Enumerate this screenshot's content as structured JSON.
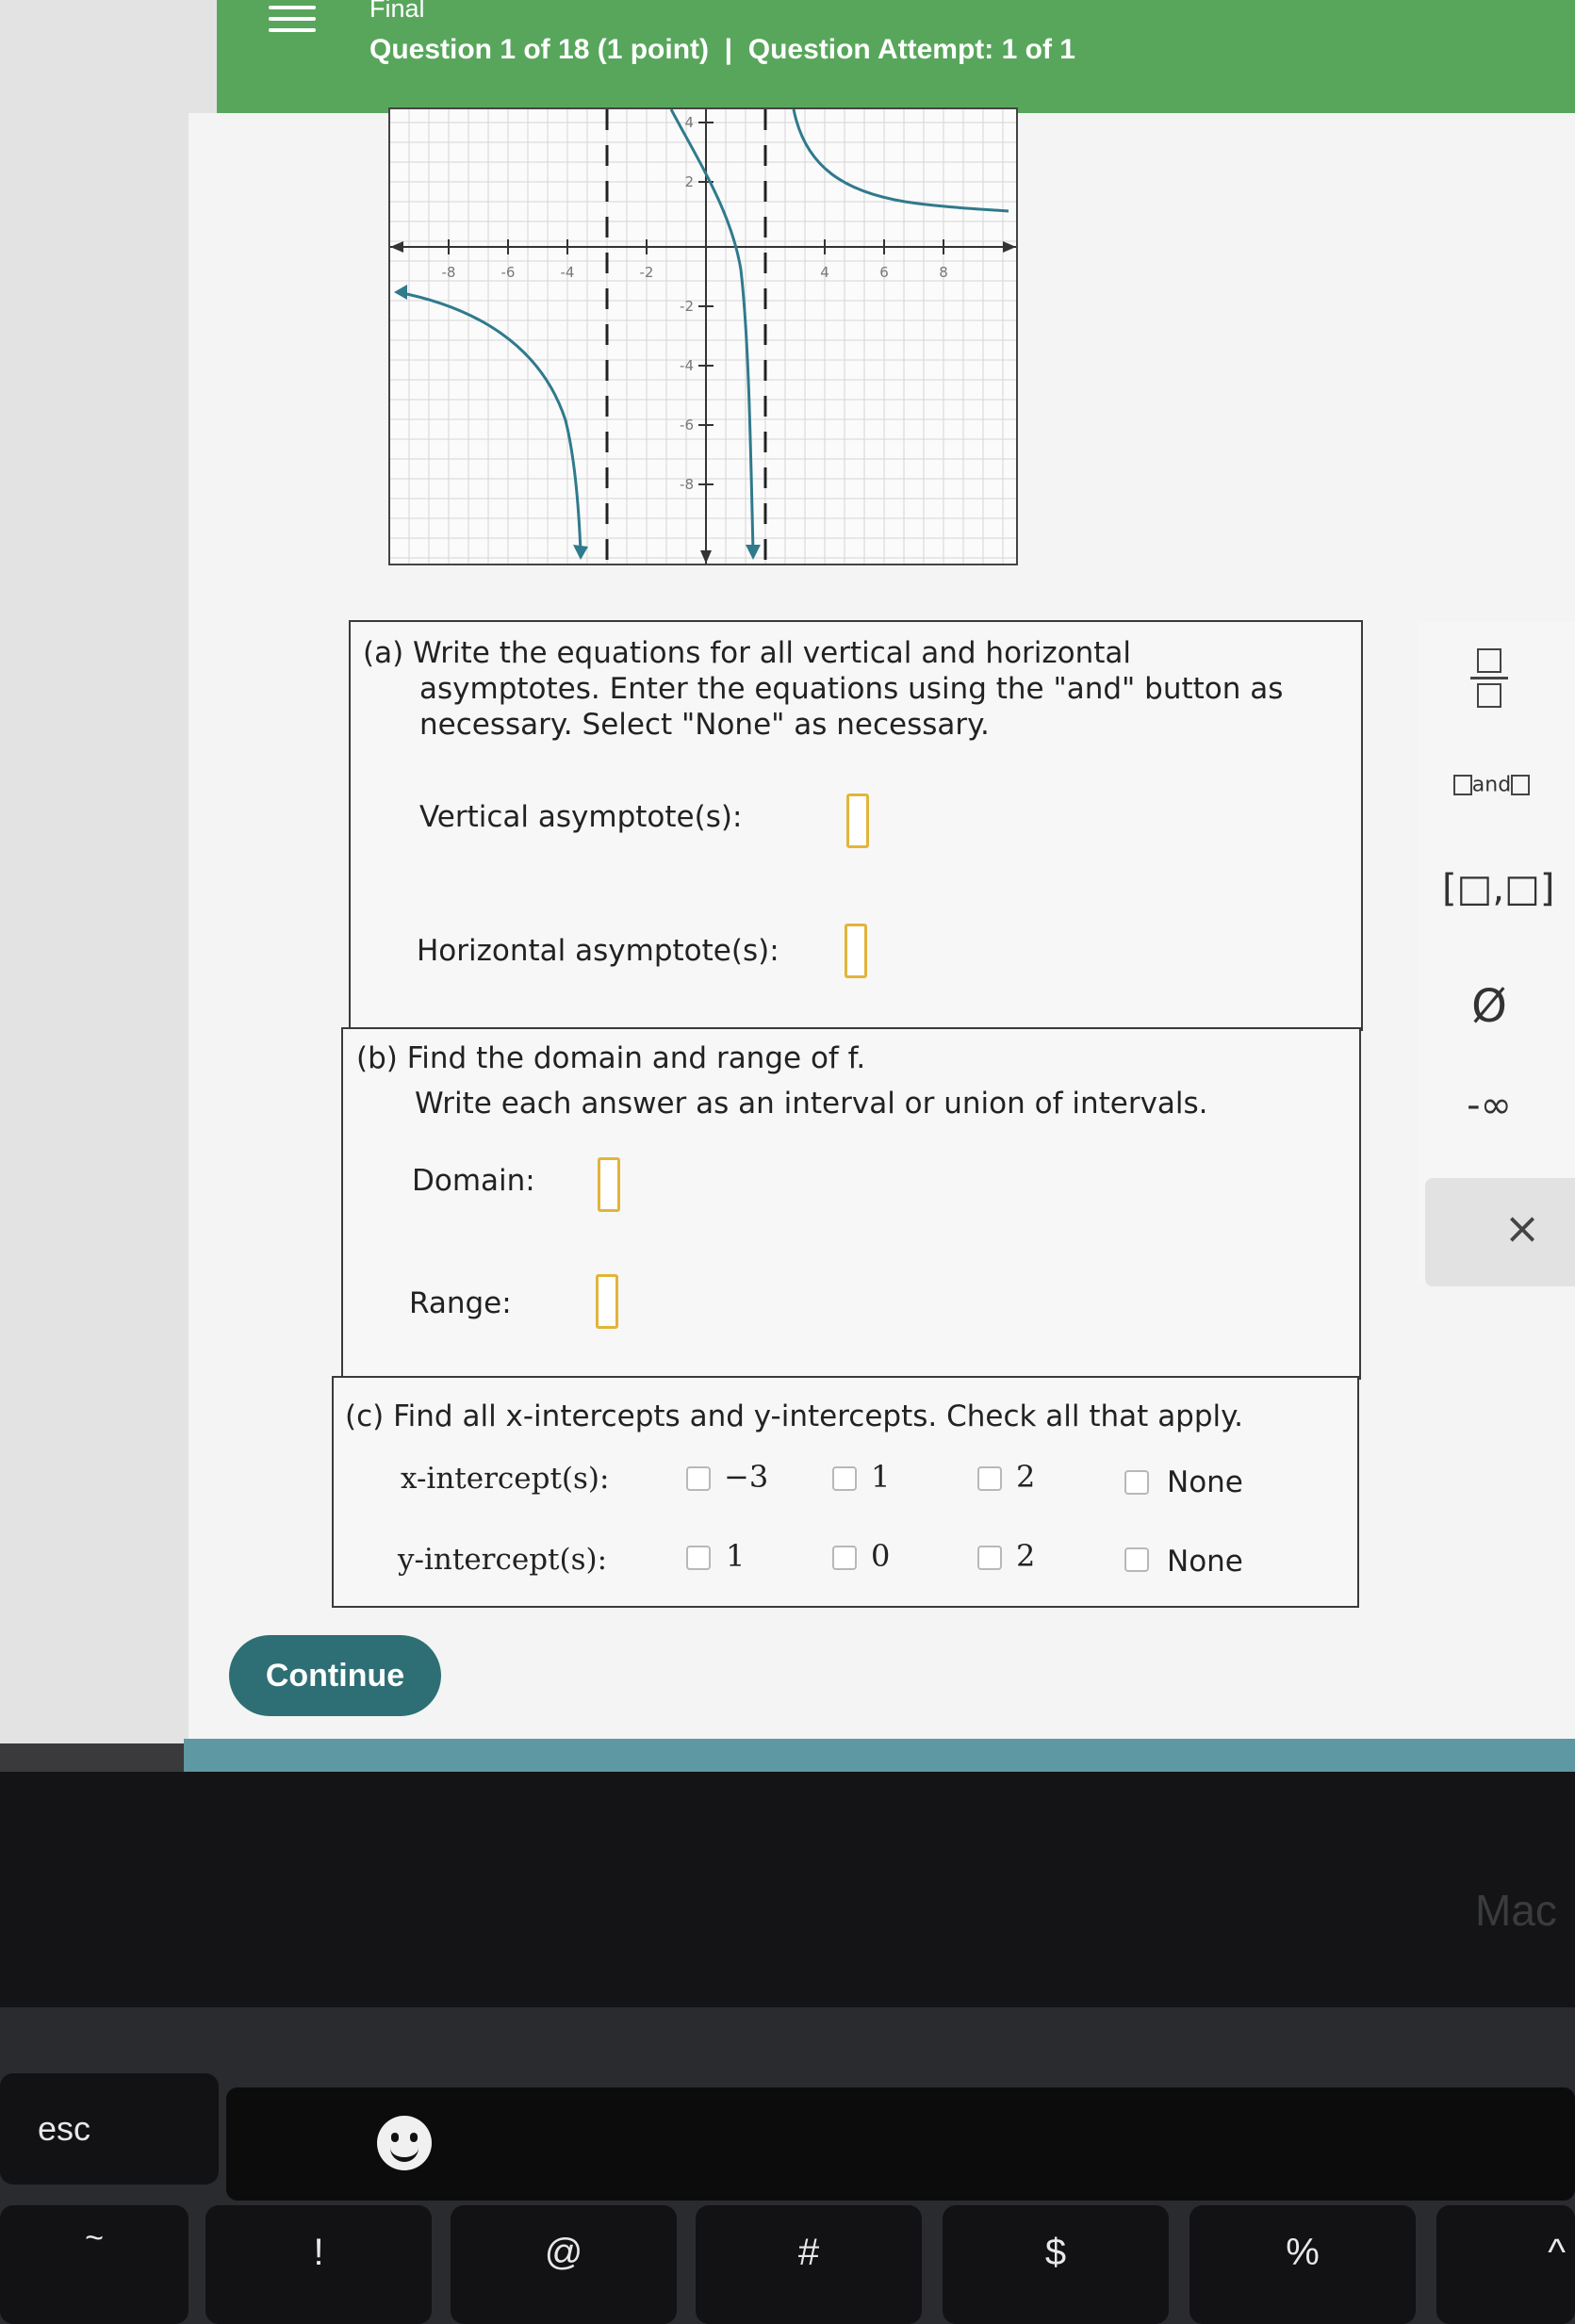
{
  "header": {
    "title": "Final",
    "subtitle": "Question 1 of 18 (1 point)  |  Question Attempt: 1 of 1"
  },
  "graph": {
    "x_tick_labels": [
      "-8",
      "-6",
      "-4",
      "-2",
      "4",
      "6",
      "8"
    ],
    "y_tick_labels": [
      "4",
      "2",
      "-2",
      "-4",
      "-6",
      "-8"
    ]
  },
  "part_a": {
    "prompt_line1": "(a) Write the equations for all vertical and horizontal",
    "prompt_line2": "asymptotes. Enter the equations using the \"and\" button as",
    "prompt_line3": "necessary. Select \"None\" as necessary.",
    "vertical_label": "Vertical asymptote(s):",
    "horizontal_label": "Horizontal asymptote(s):"
  },
  "part_b": {
    "prompt_line1": "(b) Find the domain and range of f.",
    "prompt_line2": "Write each answer as an interval or union of intervals.",
    "domain_label": "Domain:",
    "range_label": "Range:"
  },
  "part_c": {
    "prompt": "(c) Find all x-intercepts and y-intercepts. Check all that apply.",
    "x_label": "x-intercept(s):",
    "y_label": "y-intercept(s):",
    "x_options": [
      "−3",
      "1",
      "2",
      "None"
    ],
    "y_options": [
      "1",
      "0",
      "2",
      "None"
    ]
  },
  "toolbar": {
    "and_label": "and",
    "interval_label": "[□,□]",
    "empty_set": "Ø",
    "neg_infinity": "-∞",
    "clear": "×"
  },
  "continue_label": "Continue",
  "bezel_brand": "Mac",
  "keys": {
    "esc": "esc",
    "tilde": "~",
    "exclaim": "!",
    "at": "@",
    "hash": "#",
    "dollar": "$",
    "percent": "%",
    "caret": "^"
  }
}
